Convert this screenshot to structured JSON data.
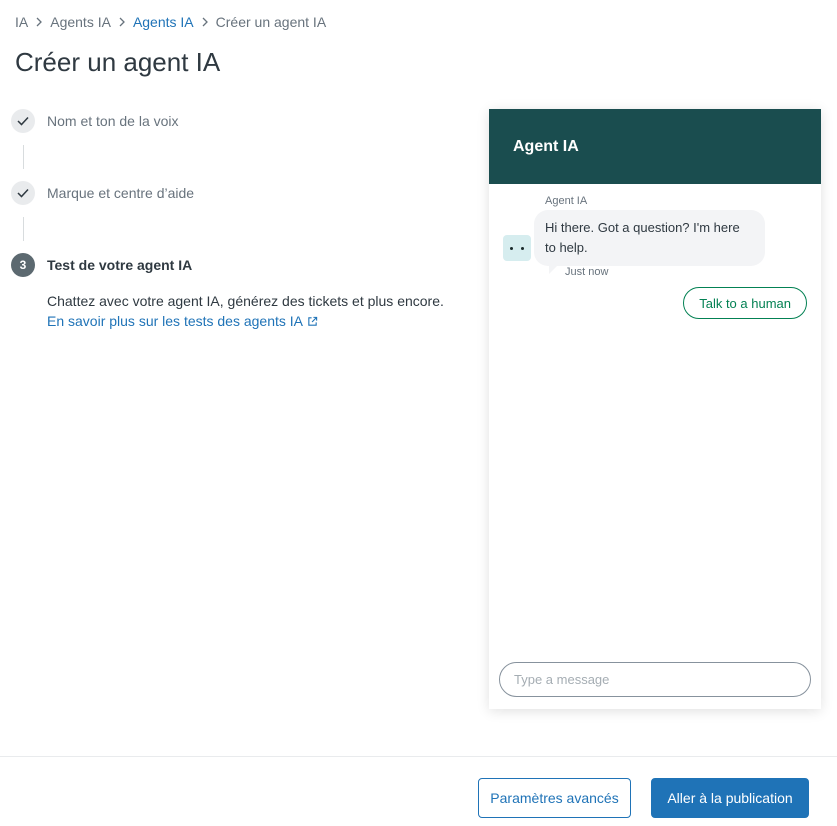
{
  "breadcrumb": {
    "items": [
      {
        "label": "IA"
      },
      {
        "label": "Agents IA"
      },
      {
        "label": "Agents IA"
      },
      {
        "label": "Créer un agent IA"
      }
    ]
  },
  "page": {
    "title": "Créer un agent IA"
  },
  "steps": {
    "step1": {
      "label": "Nom et ton de la voix",
      "status": "done"
    },
    "step2": {
      "label": "Marque et centre d’aide",
      "status": "done"
    },
    "step3": {
      "number": "3",
      "label": "Test de votre agent IA",
      "status": "active",
      "description": "Chattez avec votre agent IA, générez des tickets et plus encore.",
      "link": "En savoir plus sur les tests des agents IA"
    }
  },
  "widget": {
    "title": "Agent IA",
    "sender": "Agent IA",
    "message": "Hi there. Got a question? I'm here to help.",
    "timestamp": "Just now",
    "quick_reply": "Talk to a human",
    "composer_placeholder": "Type a message",
    "header_color": "#1a4d4f"
  },
  "footer": {
    "secondary_button": "Paramètres avancés",
    "primary_button": "Aller à la publication"
  },
  "colors": {
    "accent": "#1f73b7",
    "success": "#038153"
  }
}
